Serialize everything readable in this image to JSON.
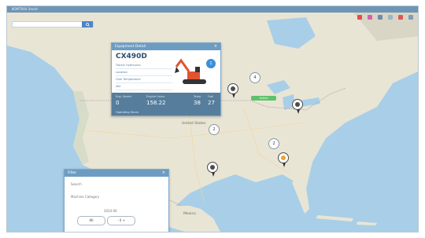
{
  "window": {
    "title": "KOMTRAX Smart",
    "search_placeholder": ""
  },
  "map": {
    "labels": {
      "country": "United States",
      "mexico": "Mexico"
    },
    "zoom_label": ""
  },
  "equipment_card": {
    "header": "Equipment Detail",
    "model": "CX490D",
    "rows": [
      "Tractor Hydraulics",
      "Location",
      "Over Temperature",
      "Idle"
    ],
    "badge": "1",
    "stats": [
      {
        "label": "Eng. Speed",
        "value": "0"
      },
      {
        "label": "Engine Hours",
        "value": "158.22"
      },
      {
        "label": "Temp",
        "value": "38"
      },
      {
        "label": "Fuel",
        "value": "27"
      }
    ],
    "footer": "Operating Hours"
  },
  "control_card": {
    "header": "Filter",
    "field1": "Search",
    "field2": "Machine Category",
    "pill_label": "All",
    "date_label": "2024-06",
    "stepper": "- 0 +"
  },
  "clusters": [
    "4",
    "2",
    "2"
  ],
  "status_tag": "Active",
  "colors": {
    "titlebar": "#6f95b4",
    "accent": "#3d8fd9",
    "stats_bg": "#567e9c",
    "water": "#a9cfe8",
    "land": "#e9e5d5"
  }
}
